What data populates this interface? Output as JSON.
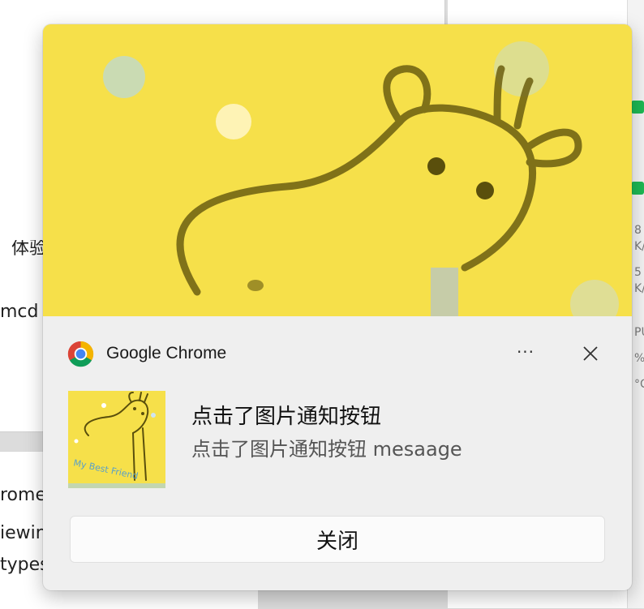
{
  "background": {
    "left_texts": [
      "体验",
      "mcd",
      "rome",
      "iewin",
      "types"
    ],
    "edge_texts": [
      "8",
      "K/",
      "5",
      "K/",
      "PU",
      "%",
      "°C"
    ]
  },
  "toast": {
    "app_name": "Google Chrome",
    "title": "点击了图片通知按钮",
    "message": "点击了图片通知按钮 mesaage",
    "action_label": "关闭",
    "more_glyph": "···",
    "thumb_caption": "My Best Friend"
  },
  "colors": {
    "hero_yellow": "#f6e04a",
    "toast_bg": "#efefef"
  }
}
